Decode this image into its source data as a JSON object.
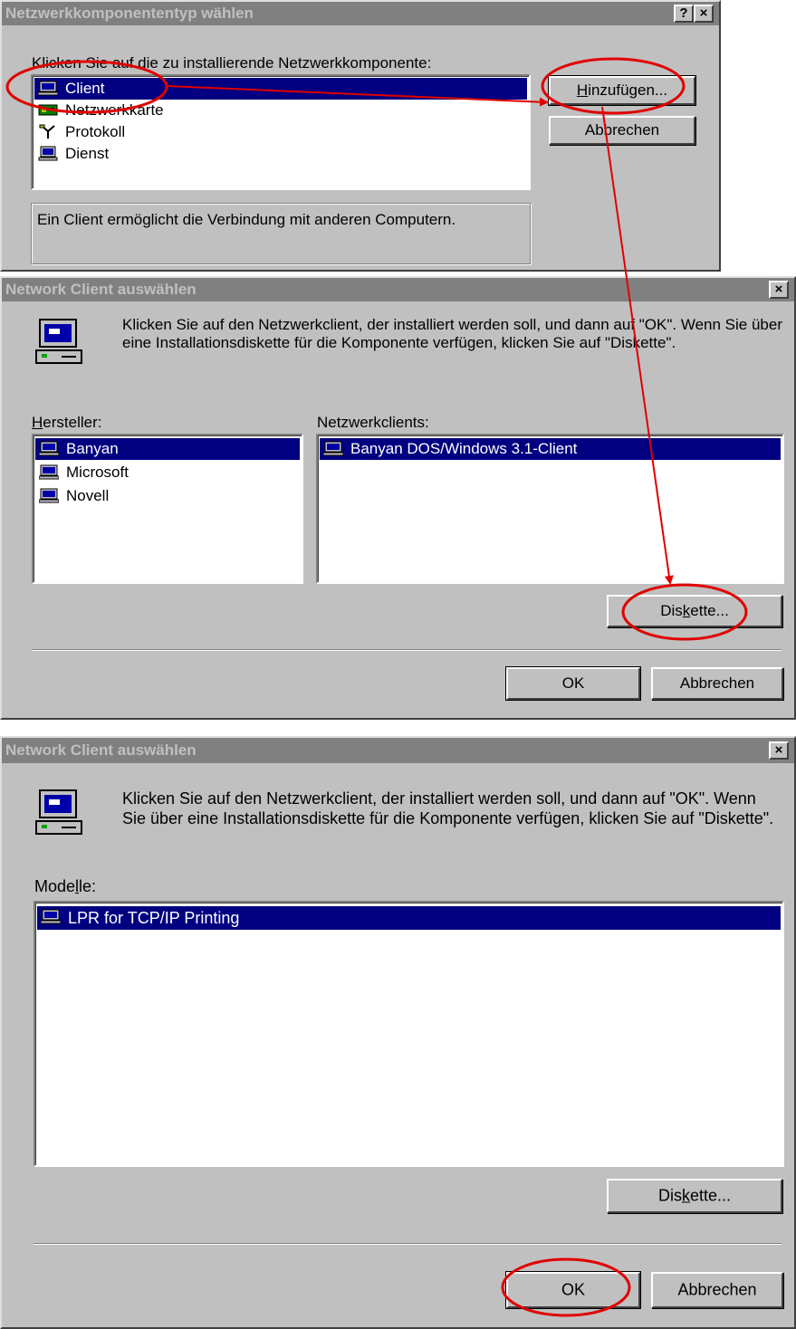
{
  "dialog1": {
    "title": "Netzwerkkomponententyp wählen",
    "help_btn": "?",
    "close_btn": "×",
    "prompt": "Klicken Sie auf die zu installierende Netzwerkkomponente:",
    "items": [
      {
        "label": "Client",
        "icon": "network-client-icon"
      },
      {
        "label": "Netzwerkkarte",
        "icon": "network-adapter-icon"
      },
      {
        "label": "Protokoll",
        "icon": "protocol-icon"
      },
      {
        "label": "Dienst",
        "icon": "service-icon"
      }
    ],
    "add_btn_pre": "",
    "add_btn_ul": "H",
    "add_btn_post": "inzufügen...",
    "cancel_btn": "Abbrechen",
    "description": "Ein Client ermöglicht die Verbindung mit anderen Computern."
  },
  "dialog2": {
    "title": "Network Client auswählen",
    "close_btn": "×",
    "info": "Klicken Sie auf den Netzwerkclient, der installiert werden soll, und dann auf \"OK\". Wenn Sie über eine Installationsdiskette für die Komponente verfügen, klicken Sie auf \"Diskette\".",
    "manufacturer_label_ul": "H",
    "manufacturer_label_rest": "ersteller:",
    "manufacturers": [
      "Banyan",
      "Microsoft",
      "Novell"
    ],
    "clients_label": "Netzwerkclients:",
    "clients": [
      "Banyan DOS/Windows 3.1-Client"
    ],
    "disk_btn_pre": "Dis",
    "disk_btn_ul": "k",
    "disk_btn_post": "ette...",
    "ok_btn": "OK",
    "cancel_btn": "Abbrechen"
  },
  "dialog3": {
    "title": "Network Client auswählen",
    "close_btn": "×",
    "info": "Klicken Sie auf den Netzwerkclient, der installiert werden soll, und dann auf \"OK\". Wenn Sie über eine Installationsdiskette für die Komponente verfügen, klicken Sie auf \"Diskette\".",
    "models_label_pre": "Mode",
    "models_label_ul": "l",
    "models_label_post": "le:",
    "models": [
      "LPR for TCP/IP Printing"
    ],
    "disk_btn_pre": "Dis",
    "disk_btn_ul": "k",
    "disk_btn_post": "ette...",
    "ok_btn": "OK",
    "cancel_btn": "Abbrechen"
  },
  "colors": {
    "annotation": "#e00000",
    "selection": "#000080",
    "face": "#c0c0c0",
    "titlebar_inactive": "#808080"
  }
}
